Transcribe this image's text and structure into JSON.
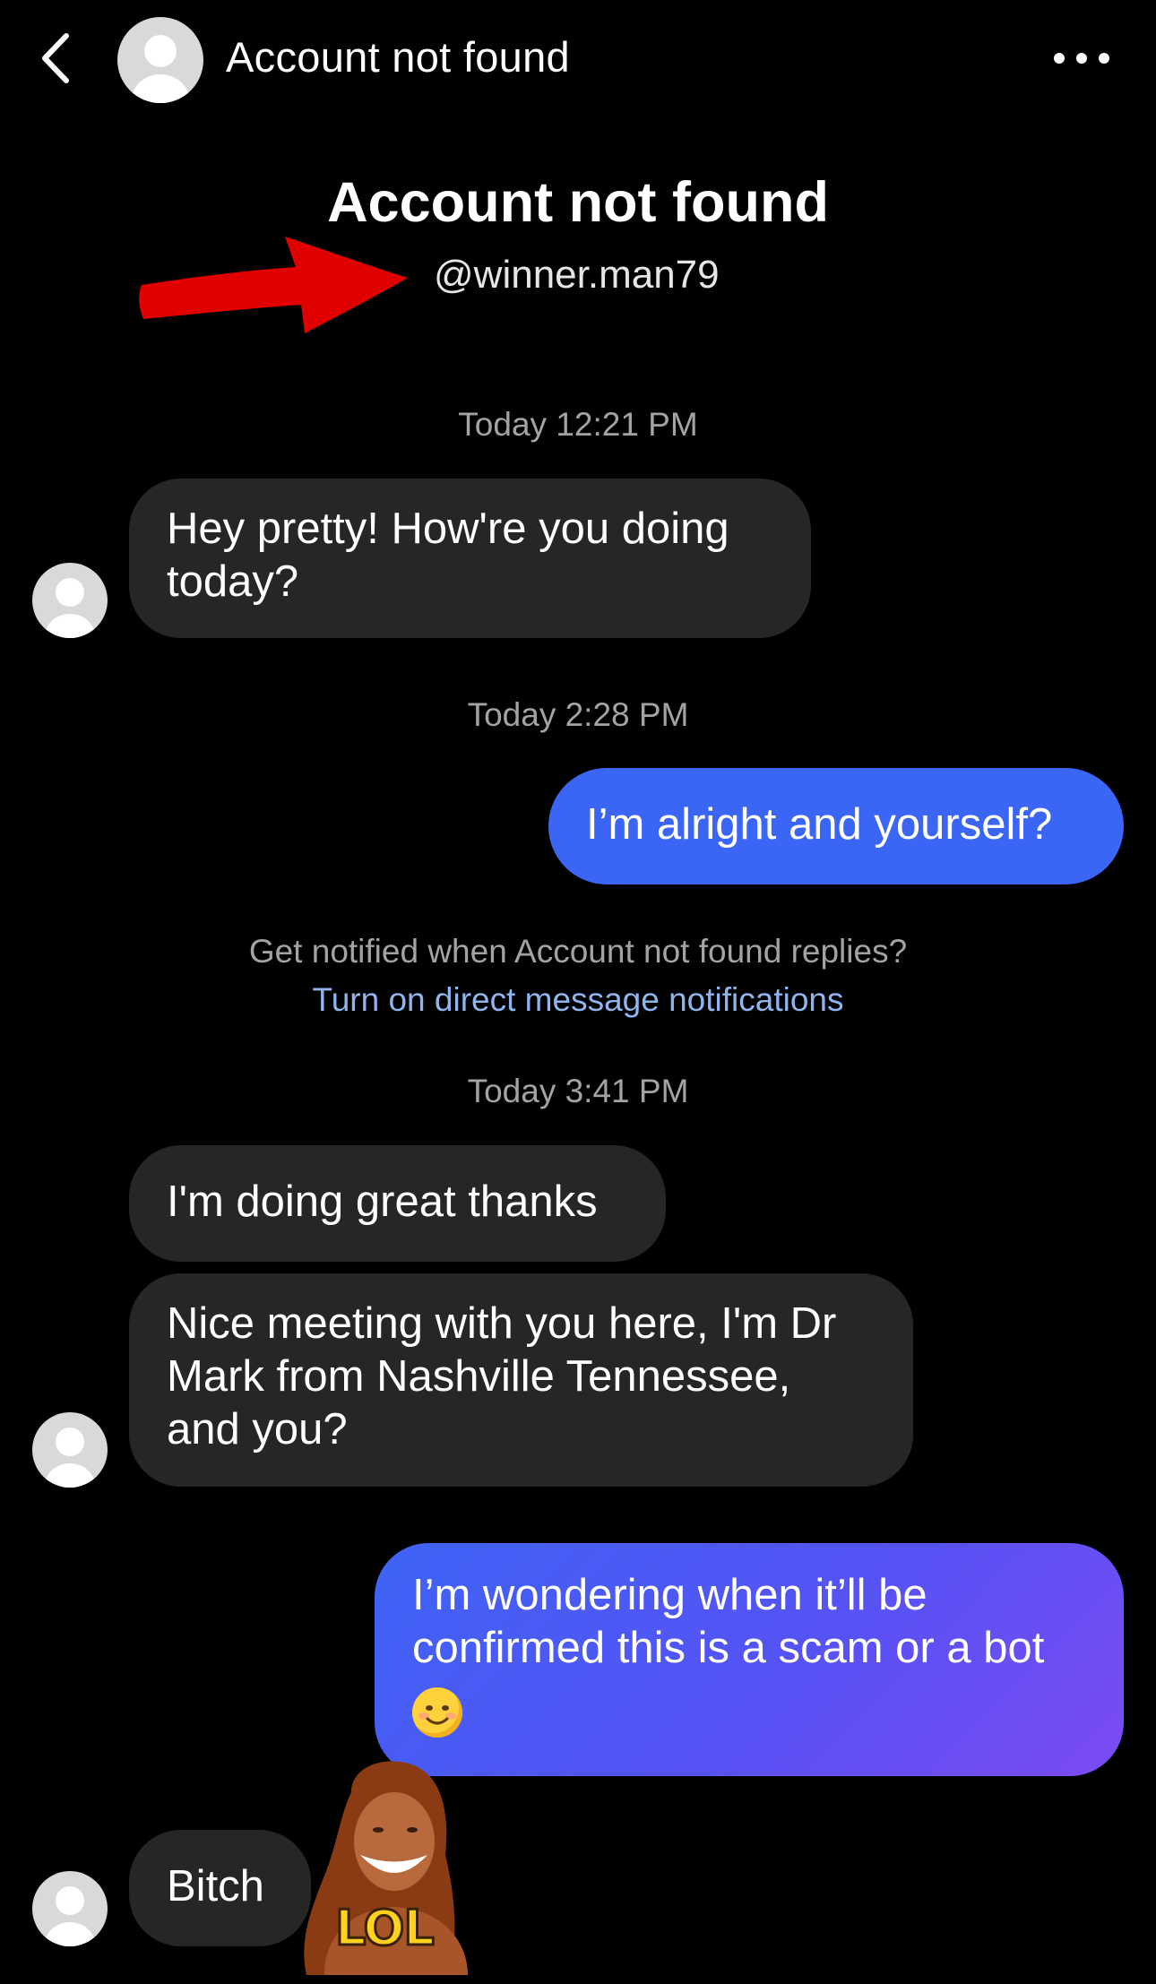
{
  "header": {
    "title": "Account not found",
    "back_icon": "chevron-left-icon",
    "more_icon": "more-horizontal-icon"
  },
  "profile": {
    "name": "Account not found",
    "handle": "@winner.man79"
  },
  "messages": [
    {
      "type": "timestamp",
      "text": "Today 12:21 PM"
    },
    {
      "type": "incoming",
      "text": "Hey pretty! How're you doing\ntoday?"
    },
    {
      "type": "timestamp",
      "text": "Today 2:28 PM"
    },
    {
      "type": "outgoing",
      "text": "I’m alright and yourself?"
    },
    {
      "type": "timestamp",
      "text": "Today 3:41 PM"
    },
    {
      "type": "incoming",
      "text": "I'm doing great thanks"
    },
    {
      "type": "incoming",
      "text": "Nice meeting with you here, I'm Dr\nMark from Nashville Tennessee,\nand you?"
    },
    {
      "type": "outgoing",
      "text": "I’m wondering when it’ll be confirmed this is a scam or a bot",
      "emoji": "smiling-face-emoji"
    },
    {
      "type": "incoming",
      "text": "Bitch"
    }
  ],
  "notification_prompt": {
    "question": "Get notified when Account not found replies?",
    "link": "Turn on direct message notifications"
  },
  "sticker": {
    "caption": "LOL"
  },
  "colors": {
    "background": "#000000",
    "incoming_bubble": "#262626",
    "outgoing_bubble": "#3b66f5",
    "outgoing_gradient_end": "#7c4bf2",
    "link": "#8fb4ee",
    "timestamp": "#a3a3a3",
    "annotation_arrow": "#e00000"
  }
}
